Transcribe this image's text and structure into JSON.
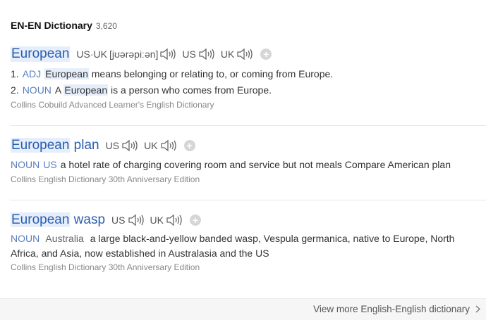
{
  "header": {
    "title": "EN-EN Dictionary",
    "count": "3,620"
  },
  "entries": [
    {
      "headword": "European",
      "pron": {
        "combined_label": "US·UK",
        "ipa": "[jʊərəpiːən]",
        "us_label": "US",
        "uk_label": "UK"
      },
      "senses": [
        {
          "num": "1.",
          "pos": "ADJ",
          "hl": "European",
          "rest": " means belonging or relating to, or coming from Europe.",
          "pre": ""
        },
        {
          "num": "2.",
          "pos": "NOUN",
          "pre": "A ",
          "hl": "European",
          "rest": " is a person who comes from Europe."
        }
      ],
      "source": "Collins Cobuild Advanced Learner's English Dictionary"
    },
    {
      "headword_hl": "European",
      "headword_rest": " plan",
      "pron": {
        "us_label": "US",
        "uk_label": "UK"
      },
      "sense": {
        "pos": "NOUN",
        "region": "US",
        "text": "a hotel rate of charging covering room and service but not meals Compare American plan"
      },
      "source": "Collins English Dictionary 30th Anniversary Edition"
    },
    {
      "headword_hl": "European",
      "headword_rest": " wasp",
      "pron": {
        "us_label": "US",
        "uk_label": "UK"
      },
      "sense": {
        "pos": "NOUN",
        "region": "Australia",
        "text": "a large black-and-yellow banded wasp, Vespula germanica, native to Europe, North Africa, and Asia, now established in Australasia and the US"
      },
      "source": "Collins English Dictionary 30th Anniversary Edition"
    }
  ],
  "footer": {
    "more_label": "View more English-English dictionary"
  },
  "colors": {
    "headword": "#2a5db0",
    "highlight": "#e5eefa",
    "pos": "#5a7fbf",
    "source": "#888888"
  },
  "icons": {
    "speaker": "speaker-icon",
    "add": "plus-icon",
    "chevron": "chevron-right-icon"
  }
}
